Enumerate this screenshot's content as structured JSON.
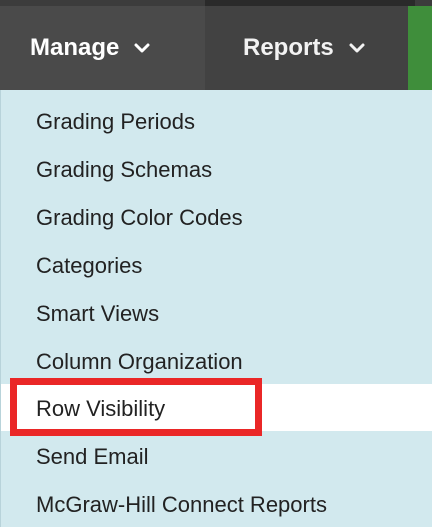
{
  "nav": {
    "manage_label": "Manage",
    "reports_label": "Reports",
    "manage_icon": "chevron-down-icon",
    "reports_icon": "chevron-down-icon"
  },
  "menu": {
    "items": [
      {
        "label": "Grading Periods"
      },
      {
        "label": "Grading Schemas"
      },
      {
        "label": "Grading Color Codes"
      },
      {
        "label": "Categories"
      },
      {
        "label": "Smart Views"
      },
      {
        "label": "Column Organization"
      },
      {
        "label": "Row Visibility",
        "highlighted": true
      },
      {
        "label": "Send Email"
      },
      {
        "label": "McGraw-Hill Connect Reports"
      }
    ]
  },
  "colors": {
    "nav_bg": "#4a4a4a",
    "menu_bg": "#d2e9ee",
    "highlight_bg": "#ffffff",
    "annotation_border": "#ea2727",
    "accent_green": "#3f8e3b"
  }
}
